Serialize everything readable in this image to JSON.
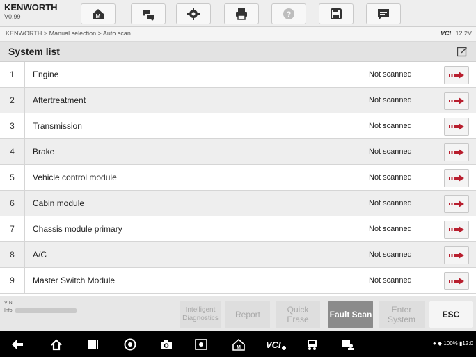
{
  "header": {
    "brand": "KENWORTH",
    "version": "V0.99",
    "tools": [
      {
        "icon": "home-icon"
      },
      {
        "icon": "vehicle-swap-icon"
      },
      {
        "icon": "gear-icon"
      },
      {
        "icon": "printer-icon"
      },
      {
        "icon": "help-icon"
      },
      {
        "icon": "save-icon"
      },
      {
        "icon": "message-icon"
      }
    ]
  },
  "breadcrumb": "KENWORTH > Manual selection > Auto scan",
  "vci_label": "VCI",
  "battery_voltage": "12.2V",
  "list": {
    "title": "System list",
    "rows": [
      {
        "num": "1",
        "name": "Engine",
        "status": "Not scanned"
      },
      {
        "num": "2",
        "name": "Aftertreatment",
        "status": "Not scanned"
      },
      {
        "num": "3",
        "name": "Transmission",
        "status": "Not scanned"
      },
      {
        "num": "4",
        "name": "Brake",
        "status": "Not scanned"
      },
      {
        "num": "5",
        "name": "Vehicle control module",
        "status": "Not scanned"
      },
      {
        "num": "6",
        "name": "Cabin module",
        "status": "Not scanned"
      },
      {
        "num": "7",
        "name": "Chassis module primary",
        "status": "Not scanned"
      },
      {
        "num": "8",
        "name": "A/C",
        "status": "Not scanned"
      },
      {
        "num": "9",
        "name": "Master Switch Module",
        "status": "Not scanned"
      }
    ]
  },
  "footer": {
    "vin_label": "VIN:",
    "info_label": "Info:",
    "buttons": {
      "intelligent_diagnostics": "Intelligent Diagnostics",
      "report": "Report",
      "quick_erase": "Quick Erase",
      "fault_scan": "Fault Scan",
      "enter_system": "Enter System",
      "esc": "ESC"
    }
  },
  "statusbar": {
    "battery": "100%",
    "time": "12:0"
  },
  "colors": {
    "accent_active": "#8b8b8b",
    "disabled_text": "#a9a9a9",
    "arrow": "#b81e2e"
  }
}
